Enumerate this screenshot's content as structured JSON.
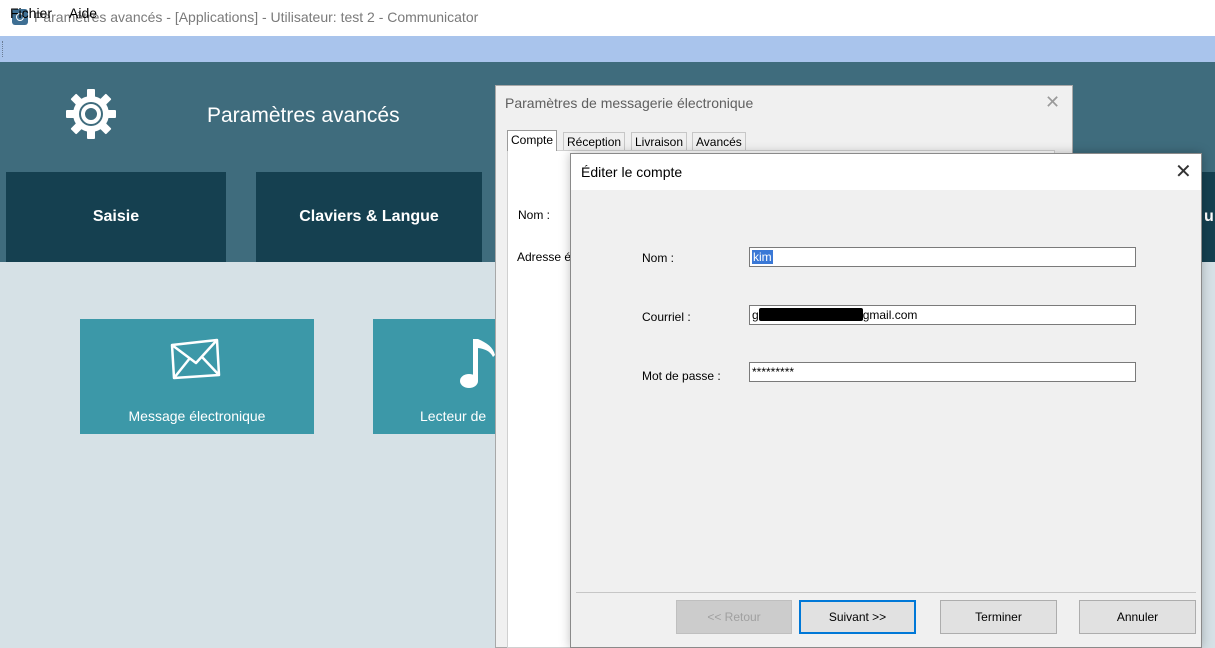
{
  "window": {
    "title": "Paramètres avancés -  [Applications] - Utilisateur: test 2 - Communicator"
  },
  "menu": [
    "Fichier",
    "Aide"
  ],
  "header": {
    "title": "Paramètres avancés",
    "icon": "gear-icon"
  },
  "tabs": [
    "Saisie",
    "Claviers & Langue",
    "u"
  ],
  "tiles": [
    {
      "label": "Message électronique",
      "icon": "envelope-icon"
    },
    {
      "label": "Lecteur de",
      "icon": "music-note-icon"
    }
  ],
  "email_dialog": {
    "title": "Paramètres de messagerie électronique",
    "tabs": [
      "Compte",
      "Réception",
      "Livraison",
      "Avancés"
    ],
    "labels": {
      "nom": "Nom :",
      "adresse": "Adresse é"
    }
  },
  "edit_dialog": {
    "title": "Éditer le compte",
    "fields": {
      "nom_label": "Nom :",
      "nom_value": "kim",
      "courriel_label": "Courriel :",
      "courriel_prefix": "g",
      "courriel_suffix": "gmail.com",
      "password_label": "Mot de passe :",
      "password_value": "*********"
    },
    "buttons": {
      "back": "<< Retour",
      "next": "Suivant >>",
      "finish": "Terminer",
      "cancel": "Annuler"
    }
  },
  "colors": {
    "menubar": "#a9c4ec",
    "header": "#3f6c7d",
    "tab": "#154050",
    "content": "#d6e1e6",
    "tile": "#3c98a8",
    "selection": "#3a78d6",
    "focus": "#0078d7"
  }
}
